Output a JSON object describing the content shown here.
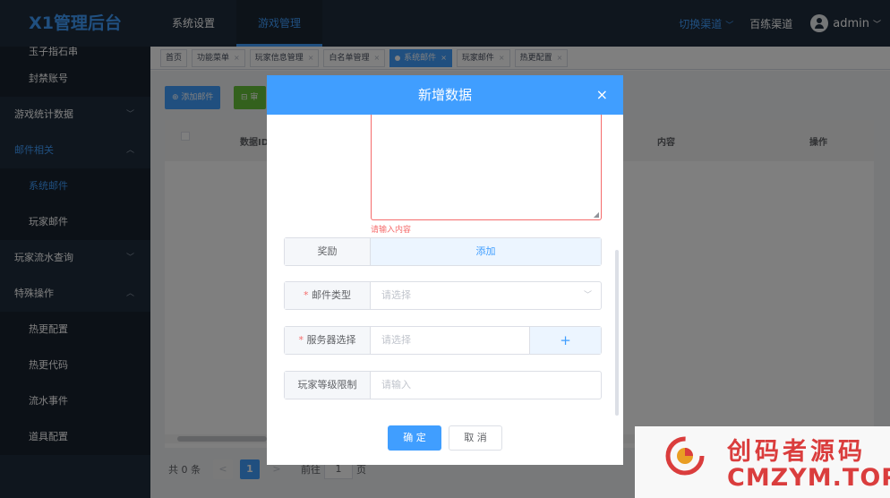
{
  "header": {
    "logo": "X1管理后台",
    "menu": [
      "系统设置",
      "游戏管理"
    ],
    "switch_label": "切换渠道",
    "channel": "百练渠道",
    "username": "admin"
  },
  "sidebar": {
    "items": [
      {
        "label": "玉子指石串",
        "level": 2
      },
      {
        "label": "封禁账号",
        "level": 2
      },
      {
        "label": "游戏统计数据",
        "level": 1,
        "arrow": "﹀"
      },
      {
        "label": "邮件相关",
        "level": 1,
        "arrow": "︿"
      },
      {
        "label": "系统邮件",
        "level": 2
      },
      {
        "label": "玩家邮件",
        "level": 2
      },
      {
        "label": "玩家流水查询",
        "level": 1,
        "arrow": "﹀"
      },
      {
        "label": "特殊操作",
        "level": 1,
        "arrow": "︿"
      },
      {
        "label": "热更配置",
        "level": 2
      },
      {
        "label": "热更代码",
        "level": 2
      },
      {
        "label": "流水事件",
        "level": 2
      },
      {
        "label": "道具配置",
        "level": 2
      }
    ]
  },
  "tags": [
    "首页",
    "功能菜单",
    "玩家信息管理",
    "白名单管理",
    "系统邮件",
    "玩家邮件",
    "热更配置"
  ],
  "toolbar": {
    "add_label": "⊕ 添加邮件",
    "audit_label": "⊟ 审核"
  },
  "table": {
    "columns": [
      "数据ID",
      "内容",
      "操作"
    ]
  },
  "pagination": {
    "total": "共 0 条",
    "prev": "<",
    "page": "1",
    "next": ">",
    "goto": "前往",
    "goto_value": "1",
    "page_unit": "页"
  },
  "dialog": {
    "title": "新增数据",
    "close": "×",
    "content_error": "请输入内容",
    "resize_grip": "◢",
    "fields": {
      "reward_label": "奖励",
      "reward_add": "添加",
      "mail_type_label": "邮件类型",
      "mail_type_placeholder": "请选择",
      "server_label": "服务器选择",
      "server_placeholder": "请选择",
      "server_add": "+",
      "level_label": "玩家等级限制",
      "level_placeholder": "请输入",
      "required_mark": "*",
      "select_arrow": "﹀"
    },
    "confirm": "确 定",
    "cancel": "取 消"
  },
  "watermark": {
    "cn": "创码者源码",
    "en": "CMZYM.TOP"
  },
  "colors": {
    "primary": "#409eff",
    "sidebar_bg": "#1f2d3d",
    "danger": "#f56c6c",
    "success": "#67c23a"
  }
}
